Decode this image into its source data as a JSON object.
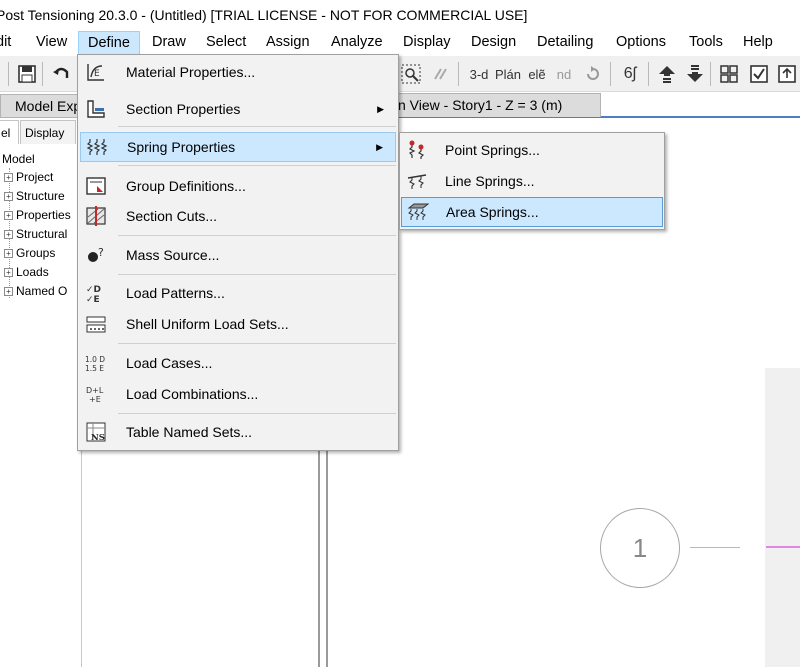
{
  "title": "Post Tensioning 20.3.0 - (Untitled)  [TRIAL LICENSE - NOT FOR COMMERCIAL USE]",
  "menubar": [
    "dit",
    "View",
    "Define",
    "Draw",
    "Select",
    "Assign",
    "Analyze",
    "Display",
    "Design",
    "Detailing",
    "Options",
    "Tools",
    "Help"
  ],
  "toolbar": {
    "view_3d": "3-d",
    "plan": "Plán",
    "elev": "elẽ",
    "nd": "nd",
    "glasses": "6ʃ"
  },
  "left_panel": {
    "header": "Model Exp",
    "tabs": [
      "el",
      "Display"
    ],
    "root": "Model",
    "nodes": [
      "Project",
      "Structure",
      "Properties",
      "Structural",
      "Groups",
      "Loads",
      "Named O"
    ]
  },
  "doc_tab": "n View - Story1 - Z = 3 (m)",
  "grid_bubble": "1",
  "define_menu": [
    {
      "label": "Material Properties...",
      "icon": "material-properties-icon",
      "glyph": "Ɛ̲"
    },
    {
      "label": "Section Properties",
      "icon": "section-properties-icon",
      "glyph": "╤",
      "submenu": true
    },
    {
      "label": "Spring Properties",
      "icon": "spring-properties-icon",
      "glyph": "⌇⌇",
      "submenu": true,
      "highlighted": true
    },
    {
      "label": "Group Definitions...",
      "icon": "group-definitions-icon",
      "glyph": "◩"
    },
    {
      "label": "Section Cuts...",
      "icon": "section-cuts-icon",
      "glyph": "▧"
    },
    {
      "label": "Mass Source...",
      "icon": "mass-source-icon",
      "glyph": "●?"
    },
    {
      "label": "Load Patterns...",
      "icon": "load-patterns-icon",
      "glyph": "✓D"
    },
    {
      "label": "Shell Uniform Load Sets...",
      "icon": "shell-uniform-load-sets-icon",
      "glyph": "▭"
    },
    {
      "label": "Load Cases...",
      "icon": "load-cases-icon",
      "glyph": "1.0 D"
    },
    {
      "label": "Load Combinations...",
      "icon": "load-combinations-icon",
      "glyph": "D+L"
    },
    {
      "label": "Table Named Sets...",
      "icon": "table-named-sets-icon",
      "glyph": "NS"
    }
  ],
  "spring_submenu": [
    {
      "label": "Point Springs...",
      "icon": "point-springs-icon"
    },
    {
      "label": "Line Springs...",
      "icon": "line-springs-icon"
    },
    {
      "label": "Area Springs...",
      "icon": "area-springs-icon",
      "highlighted": true
    }
  ],
  "colors": {
    "highlight": "#cce8ff",
    "highlight_border": "#99c9ef",
    "menu_bg": "#f2f2f2",
    "accent_line": "#4c7fbf",
    "pink_gridline": "#e088e0"
  }
}
